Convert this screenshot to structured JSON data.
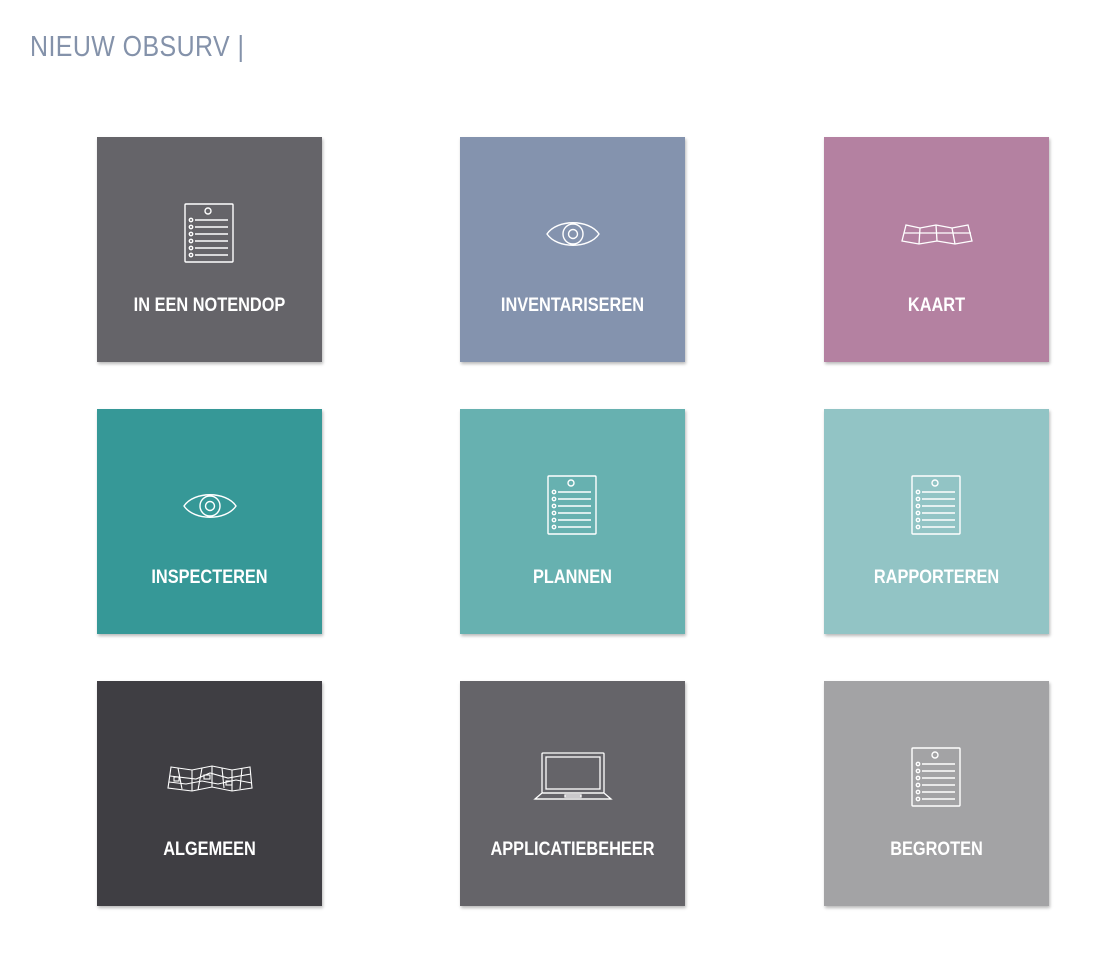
{
  "header": {
    "title": "NIEUW OBSURV |"
  },
  "tiles": [
    {
      "label": "IN EEN NOTENDOP",
      "icon": "checklist-icon",
      "color": "#656469"
    },
    {
      "label": "INVENTARISEREN",
      "icon": "eye-icon",
      "color": "#8493ae"
    },
    {
      "label": "KAART",
      "icon": "folded-map-icon",
      "color": "#b481a1"
    },
    {
      "label": "INSPECTEREN",
      "icon": "eye-icon",
      "color": "#369897"
    },
    {
      "label": "PLANNEN",
      "icon": "checklist-icon",
      "color": "#67b1b0"
    },
    {
      "label": "RAPPORTEREN",
      "icon": "checklist-icon",
      "color": "#92c4c5"
    },
    {
      "label": "ALGEMEEN",
      "icon": "street-map-icon",
      "color": "#3f3e43"
    },
    {
      "label": "APPLICATIEBEHEER",
      "icon": "laptop-icon",
      "color": "#656469"
    },
    {
      "label": "BEGROTEN",
      "icon": "checklist-icon",
      "color": "#a3a3a5"
    }
  ]
}
